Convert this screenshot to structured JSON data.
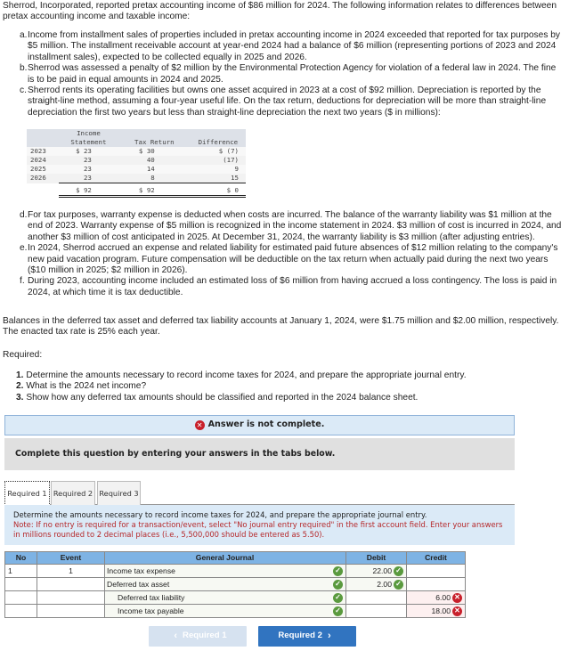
{
  "intro": "Sherrod, Incorporated, reported pretax accounting income of $86 million for 2024. The following information relates to differences between pretax accounting income and taxable income:",
  "items": [
    {
      "label": "a.",
      "text": "Income from installment sales of properties included in pretax accounting income in 2024 exceeded that reported for tax purposes by $5 million. The installment receivable account at year-end 2024 had a balance of $6 million (representing portions of 2023 and 2024 installment sales), expected to be collected equally in 2025 and 2026."
    },
    {
      "label": "b.",
      "text": "Sherrod was assessed a penalty of $2 million by the Environmental Protection Agency for violation of a federal law in 2024. The fine is to be paid in equal amounts in 2024 and 2025."
    },
    {
      "label": "c.",
      "text": "Sherrod rents its operating facilities but owns one asset acquired in 2023 at a cost of $92 million. Depreciation is reported by the straight-line method, assuming a four-year useful life. On the tax return, deductions for depreciation will be more than straight-line depreciation the first two years but less than straight-line depreciation the next two years ($ in millions):"
    },
    {
      "label": "d.",
      "text": "For tax purposes, warranty expense is deducted when costs are incurred. The balance of the warranty liability was $1 million at the end of 2023. Warranty expense of $5 million is recognized in the income statement in 2024. $3 million of cost is incurred in 2024, and another $3 million of cost anticipated in 2025. At December 31, 2024, the warranty liability is $3 million (after adjusting entries)."
    },
    {
      "label": "e.",
      "text": "In 2024, Sherrod accrued an expense and related liability for estimated paid future absences of $12 million relating to the company's new paid vacation program. Future compensation will be deductible on the tax return when actually paid during the next two years ($10 million in 2025; $2 million in 2026)."
    },
    {
      "label": "f.",
      "text": "During 2023, accounting income included an estimated loss of $6 million from having accrued a loss contingency. The loss is paid in 2024, at which time it is tax deductible."
    }
  ],
  "dep_table": {
    "header": {
      "col1_line1": "Income",
      "col1_line2": "Statement",
      "col2": "Tax Return",
      "col3": "Difference"
    },
    "rows": [
      {
        "year": "2023",
        "income_statement": "$ 23",
        "tax_return": "$ 30",
        "difference": "$ (7)"
      },
      {
        "year": "2024",
        "income_statement": "23",
        "tax_return": "40",
        "difference": "(17)"
      },
      {
        "year": "2025",
        "income_statement": "23",
        "tax_return": "14",
        "difference": "9"
      },
      {
        "year": "2026",
        "income_statement": "23",
        "tax_return": "8",
        "difference": "15"
      }
    ],
    "total": {
      "income_statement": "$ 92",
      "tax_return": "$ 92",
      "difference": "$ 0"
    }
  },
  "balances": "Balances in the deferred tax asset and deferred tax liability accounts at January 1, 2024, were $1.75 million and $2.00 million, respectively. The enacted tax rate is 25% each year.",
  "required_title": "Required:",
  "required": [
    {
      "num": "1.",
      "text": "Determine the amounts necessary to record income taxes for 2024, and prepare the appropriate journal entry."
    },
    {
      "num": "2.",
      "text": "What is the 2024 net income?"
    },
    {
      "num": "3.",
      "text": "Show how any deferred tax amounts should be classified and reported in the 2024 balance sheet."
    }
  ],
  "status": {
    "icon": "error-icon",
    "text": "Answer is not complete."
  },
  "instruction": "Complete this question by entering your answers in the tabs below.",
  "tabs": [
    {
      "label": "Required 1",
      "active": true
    },
    {
      "label": "Required 2",
      "active": false
    },
    {
      "label": "Required 3",
      "active": false
    }
  ],
  "task": {
    "text": "Determine the amounts necessary to record income taxes for 2024, and prepare the appropriate journal entry.",
    "note": "Note: If no entry is required for a transaction/event, select \"No journal entry required\" in the first account field. Enter your answers in millions rounded to 2 decimal places (i.e., 5,500,000 should be entered as 5.50)."
  },
  "journal": {
    "headers": {
      "no": "No",
      "event": "Event",
      "account": "General Journal",
      "debit": "Debit",
      "credit": "Credit"
    },
    "rows": [
      {
        "no": "1",
        "event": "1",
        "account": "Income tax expense",
        "account_status": "correct",
        "debit": "22.00",
        "debit_status": "correct",
        "credit": "",
        "credit_status": ""
      },
      {
        "no": "",
        "event": "",
        "account": "Deferred tax asset",
        "account_status": "correct",
        "debit": "2.00",
        "debit_status": "correct",
        "credit": "",
        "credit_status": ""
      },
      {
        "no": "",
        "event": "",
        "account": "Deferred tax liability",
        "account_status": "correct",
        "debit": "",
        "debit_status": "",
        "credit": "6.00",
        "credit_status": "incorrect"
      },
      {
        "no": "",
        "event": "",
        "account": "Income tax payable",
        "account_status": "correct",
        "debit": "",
        "debit_status": "",
        "credit": "18.00",
        "credit_status": "incorrect"
      }
    ]
  },
  "nav": {
    "prev_label": "Required 1",
    "next_label": "Required 2",
    "prev_icon": "chevron-left-icon",
    "next_icon": "chevron-right-icon"
  },
  "icons": {
    "check": "✓",
    "cross": "✕",
    "chev_left": "‹",
    "chev_right": "›"
  }
}
